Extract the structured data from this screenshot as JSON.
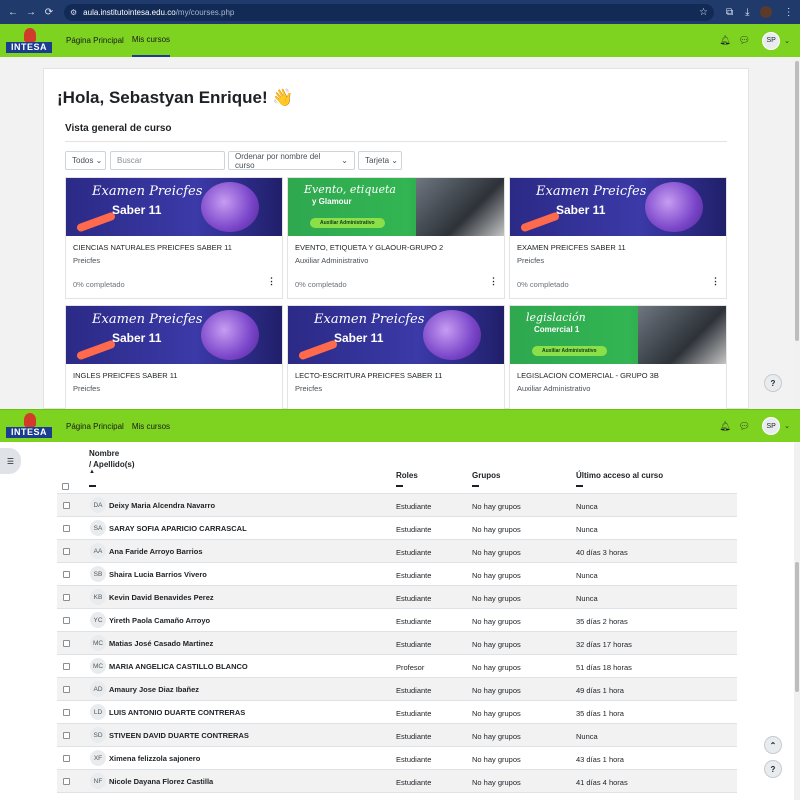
{
  "browser": {
    "url_host": "aula.institutointesa.edu.co",
    "url_path": "/my/courses.php",
    "nav_icons": [
      "back-icon",
      "forward-icon",
      "reload-icon",
      "site-info-icon"
    ],
    "right_icons": [
      "star-icon",
      "extensions-icon",
      "download-icon",
      "profile-icon",
      "more-icon"
    ]
  },
  "site": {
    "logo_text": "INTESA",
    "nav": {
      "home": "Página Principal",
      "courses": "Mis cursos"
    },
    "user_initials": "SP"
  },
  "dashboard": {
    "greeting": "¡Hola, Sebastyan Enrique! 👋",
    "overview_title": "Vista general de curso",
    "filters": {
      "all": "Todos",
      "search_placeholder": "Buscar",
      "sort": "Ordenar por nombre del curso",
      "view": "Tarjeta"
    },
    "courses": [
      {
        "name": "CIENCIAS NATURALES PREICFES SABER 11",
        "category": "Preicfes",
        "progress": "0% completado",
        "banner": "exam",
        "banner_title": "Examen Preicfes",
        "banner_sub": "Saber 11"
      },
      {
        "name": "EVENTO, ETIQUETA Y GLAOUR-GRUPO 2",
        "category": "Auxiliar Administrativo",
        "progress": "0% completado",
        "banner": "green",
        "banner_title": "Evento, etiqueta",
        "banner_sub": "y Glamour",
        "banner_pill": "Auxiliar Administrativo"
      },
      {
        "name": "EXAMEN PREICFES SABER 11",
        "category": "Preicfes",
        "progress": "0% completado",
        "banner": "exam",
        "banner_title": "Examen Preicfes",
        "banner_sub": "Saber 11"
      },
      {
        "name": "INGLES PREICFES SABER 11",
        "category": "Preicfes",
        "progress": "",
        "banner": "exam",
        "banner_title": "Examen Preicfes",
        "banner_sub": "Saber 11"
      },
      {
        "name": "LECTO-ESCRITURA PREICFES SABER 11",
        "category": "Preicfes",
        "progress": "",
        "banner": "exam",
        "banner_title": "Examen Preicfes",
        "banner_sub": "Saber 11"
      },
      {
        "name": "LEGISLACION COMERCIAL - GRUPO 3B",
        "category": "Auxiliar Administrativo",
        "progress": "",
        "banner": "green",
        "banner_title": "legislación",
        "banner_sub": "Comercial 1",
        "banner_pill": "Auxiliar Administrativo"
      }
    ]
  },
  "participants": {
    "headers": {
      "name": "Nombre",
      "surname": "/ Apellido(s)",
      "roles": "Roles",
      "groups": "Grupos",
      "last_access": "Último acceso al curso"
    },
    "rows": [
      {
        "initials": "DA",
        "name": "Deixy Maria Alcendra Navarro",
        "role": "Estudiante",
        "group": "No hay grupos",
        "access": "Nunca"
      },
      {
        "initials": "SA",
        "name": "SARAY SOFIA APARICIO CARRASCAL",
        "role": "Estudiante",
        "group": "No hay grupos",
        "access": "Nunca"
      },
      {
        "initials": "AA",
        "name": "Ana Faride Arroyo Barrios",
        "role": "Estudiante",
        "group": "No hay grupos",
        "access": "40 días 3 horas"
      },
      {
        "initials": "SB",
        "name": "Shaira Lucia Barrios Vivero",
        "role": "Estudiante",
        "group": "No hay grupos",
        "access": "Nunca"
      },
      {
        "initials": "KB",
        "name": "Kevin David Benavides Perez",
        "role": "Estudiante",
        "group": "No hay grupos",
        "access": "Nunca"
      },
      {
        "initials": "YC",
        "name": "Yireth Paola Camaño Arroyo",
        "role": "Estudiante",
        "group": "No hay grupos",
        "access": "35 días 2 horas"
      },
      {
        "initials": "MC",
        "name": "Matias José Casado Martinez",
        "role": "Estudiante",
        "group": "No hay grupos",
        "access": "32 días 17 horas"
      },
      {
        "initials": "MC",
        "name": "MARIA ANGELICA CASTILLO BLANCO",
        "role": "Profesor",
        "group": "No hay grupos",
        "access": "51 días 18 horas"
      },
      {
        "initials": "AD",
        "name": "Amaury Jose Diaz Ibañez",
        "role": "Estudiante",
        "group": "No hay grupos",
        "access": "49 días 1 hora"
      },
      {
        "initials": "LD",
        "name": "LUIS ANTONIO DUARTE CONTRERAS",
        "role": "Estudiante",
        "group": "No hay grupos",
        "access": "35 días 1 hora"
      },
      {
        "initials": "SD",
        "name": "STIVEEN DAVID DUARTE CONTRERAS",
        "role": "Estudiante",
        "group": "No hay grupos",
        "access": "Nunca"
      },
      {
        "initials": "XF",
        "name": "Ximena felizzola sajonero",
        "role": "Estudiante",
        "group": "No hay grupos",
        "access": "43 días 1 hora"
      },
      {
        "initials": "NF",
        "name": "Nicole Dayana Florez Castilla",
        "role": "Estudiante",
        "group": "No hay grupos",
        "access": "41 días 4 horas"
      }
    ]
  },
  "colors": {
    "nav_green": "#7ed321",
    "chrome_blue": "#1f3a6b",
    "brand_blue": "#1b3d8f"
  }
}
